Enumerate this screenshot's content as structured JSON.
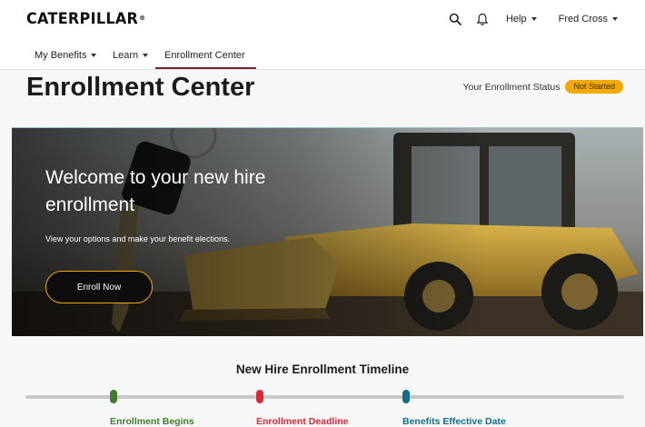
{
  "brand": {
    "name": "CATERPILLAR",
    "mark": "®"
  },
  "topbar": {
    "search_icon": "search-icon",
    "bell_icon": "bell-icon",
    "help_label": "Help",
    "user_label": "Fred Cross"
  },
  "subnav": {
    "items": [
      {
        "label": "My Benefits",
        "has_dropdown": true,
        "active": false
      },
      {
        "label": "Learn",
        "has_dropdown": true,
        "active": false
      },
      {
        "label": "Enrollment Center",
        "has_dropdown": false,
        "active": true
      }
    ]
  },
  "page": {
    "title": "Enrollment Center",
    "status_label": "Your Enrollment Status",
    "status_value": "Not Started"
  },
  "hero": {
    "heading": "Welcome to your new hire enrollment",
    "subtext": "View your options and make your benefit elections.",
    "button_label": "Enroll Now"
  },
  "timeline": {
    "title": "New Hire Enrollment Timeline",
    "milestones": [
      {
        "label": "Enrollment Begins",
        "color": "#3e7d2d"
      },
      {
        "label": "Enrollment Deadline",
        "color": "#d62b37"
      },
      {
        "label": "Benefits Effective Date",
        "color": "#0f6f8a"
      }
    ]
  },
  "colors": {
    "accent": "#f2a900",
    "nav_active": "#7a1f2b"
  }
}
